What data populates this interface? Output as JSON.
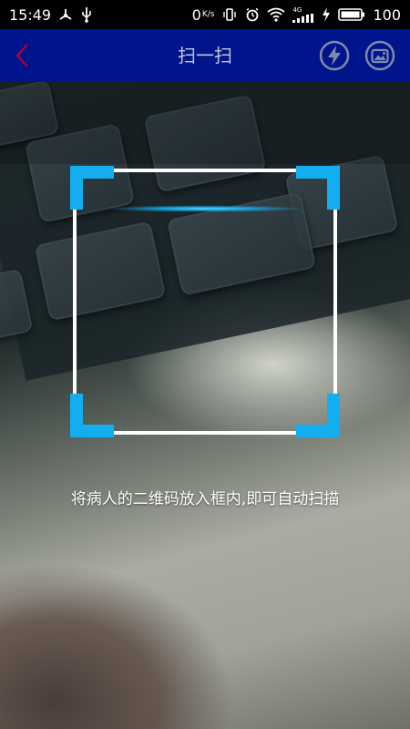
{
  "status_bar": {
    "time": "15:49",
    "network_speed": "0",
    "network_unit": "K/s",
    "signal_label": "4G",
    "battery_level": "100"
  },
  "header": {
    "title": "扫一扫",
    "background_color": "#00158c",
    "back_icon": "chevron-left-icon",
    "flash_icon": "flash-icon",
    "album_icon": "album-icon"
  },
  "scanner": {
    "accent_color": "#13aef0",
    "hint": "将病人的二维码放入框内,即可自动扫描"
  }
}
